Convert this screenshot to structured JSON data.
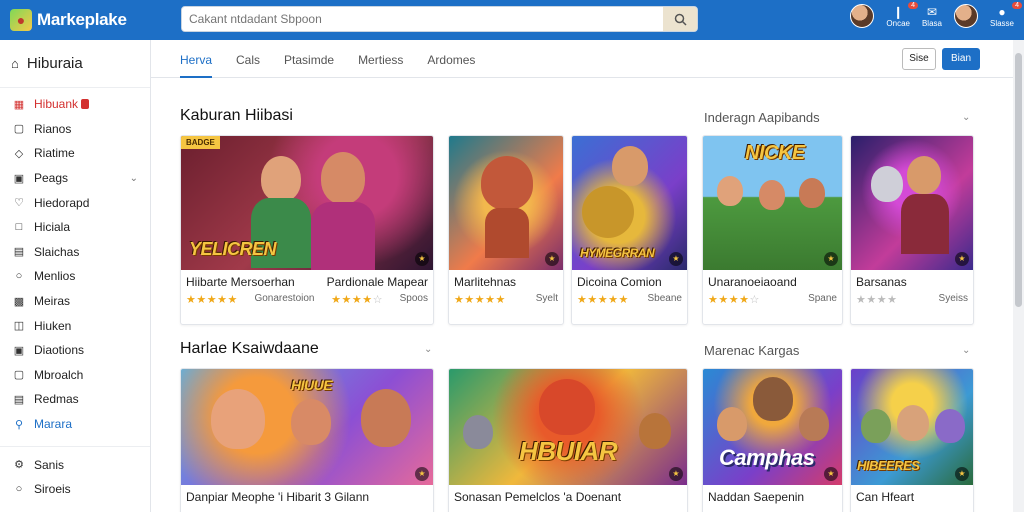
{
  "header": {
    "app_name": "Markeplake",
    "search_placeholder": "Cakant ntdadant Sbpoon",
    "icons": [
      {
        "name": "notifications-icon",
        "label": "Oncae",
        "badge": "4"
      },
      {
        "name": "messages-icon",
        "label": "Blasa",
        "badge": ""
      },
      {
        "name": "account-icon",
        "label": "Slasse",
        "badge": "4"
      }
    ]
  },
  "sidebar": {
    "title": "Hiburaia",
    "items": [
      {
        "label": "Hibuank",
        "icon": "file-icon",
        "active": true
      },
      {
        "label": "Rianos",
        "icon": "box-icon"
      },
      {
        "label": "Riatime",
        "icon": "tag-icon"
      },
      {
        "label": "Peags",
        "icon": "image-icon",
        "chevron": true
      },
      {
        "label": "Hiedorapd",
        "icon": "heart-icon"
      },
      {
        "label": "Hiciala",
        "icon": "doc-icon"
      },
      {
        "label": "Slaichas",
        "icon": "grid-icon"
      },
      {
        "label": "Menlios",
        "icon": "circle-icon"
      },
      {
        "label": "Meiras",
        "icon": "chart-icon"
      },
      {
        "label": "Hiuken",
        "icon": "book-icon"
      },
      {
        "label": "Diaotions",
        "icon": "list-icon"
      },
      {
        "label": "Mbroalch",
        "icon": "folder-icon"
      },
      {
        "label": "Redmas",
        "icon": "stack-icon"
      },
      {
        "label": "Marara",
        "icon": "user-icon",
        "blue": true
      }
    ],
    "footer_items": [
      {
        "label": "Sanis",
        "icon": "settings-icon"
      },
      {
        "label": "Siroeis",
        "icon": "info-icon"
      }
    ]
  },
  "tabs": [
    {
      "label": "Herva",
      "active": true
    },
    {
      "label": "Cals"
    },
    {
      "label": "Ptasimde"
    },
    {
      "label": "Mertiess"
    },
    {
      "label": "Ardomes"
    }
  ],
  "toolbar": {
    "ghost_label": "Sise",
    "primary_label": "Bian"
  },
  "sections": {
    "s1_title": "Kaburan Hiibasi",
    "s2_title": "Inderagn Aapibands",
    "s3_title": "Harlae Ksaiwdaane",
    "s4_title": "Marenac Kargas"
  },
  "cards": {
    "c1": {
      "tag": "BADGE",
      "logo": "YELICREN",
      "name_a": "Hiibarte Mersoerhan",
      "name_b": "Pardionale Mapear",
      "stars_a": 5,
      "meta_a": "Gonarestoion",
      "stars_b": 4,
      "meta_b": "Spoos"
    },
    "c2": {
      "name": "Marlitehnas",
      "stars": 5,
      "meta": "Syelt"
    },
    "c3": {
      "logo": "HYMEGRRAN",
      "name": "Dicoina Comion",
      "stars": 5,
      "meta": "Sbeane"
    },
    "c4": {
      "logo": "NICKE",
      "name": "Unaranoeiaoand",
      "stars": 4,
      "meta": "Spane"
    },
    "c5": {
      "name": "Barsanas",
      "stars": 0,
      "meta": "Syeiss"
    },
    "c6": {
      "logo": "HIUUE",
      "name": "Danpiar Meophe 'i Hibarit 3 Gilann"
    },
    "c7": {
      "logo": "HBUIAR",
      "name": "Sonasan Pemelclos 'a Doenant"
    },
    "c8": {
      "logo": "Camphas",
      "name": "Naddan Saepenin"
    },
    "c9": {
      "logo": "HIBEERES",
      "name": "Can Hfeart"
    }
  }
}
